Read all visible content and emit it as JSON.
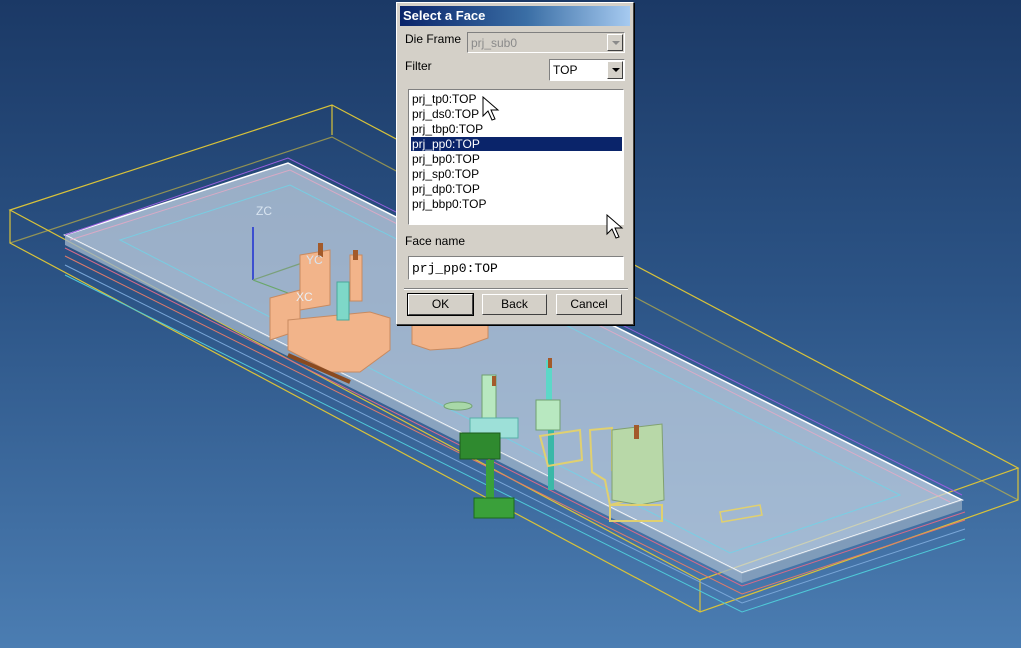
{
  "viewport": {
    "axes": {
      "z_label": "ZC",
      "y_label": "YC",
      "x_label": "XC"
    }
  },
  "dialog": {
    "title": "Select a Face",
    "die_frame_label": "Die Frame",
    "die_frame_value": "prj_sub0",
    "filter_label": "Filter",
    "filter_value": "TOP",
    "faces": [
      "prj_tp0:TOP",
      "prj_ds0:TOP",
      "prj_tbp0:TOP",
      "prj_pp0:TOP",
      "prj_bp0:TOP",
      "prj_sp0:TOP",
      "prj_dp0:TOP",
      "prj_bbp0:TOP"
    ],
    "selected_face": "prj_pp0:TOP",
    "face_name_label": "Face name",
    "face_name_value": "prj_pp0:TOP",
    "buttons": {
      "ok": "OK",
      "back": "Back",
      "cancel": "Cancel"
    }
  }
}
